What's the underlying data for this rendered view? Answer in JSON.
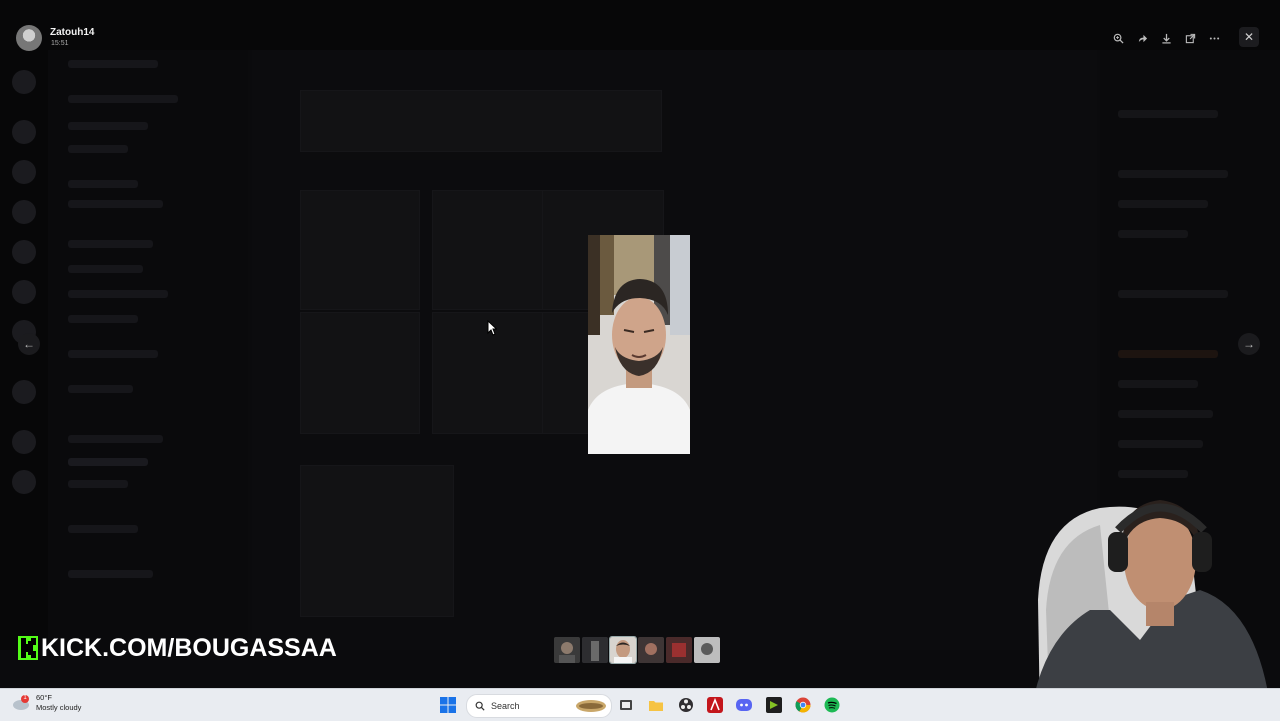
{
  "viewer": {
    "username": "Zatouh14",
    "time": "15:51",
    "toolbar_icons": [
      "zoom-in-icon",
      "forward-icon",
      "download-icon",
      "open-external-icon",
      "more-icon"
    ],
    "close_glyph": "✕",
    "prev_glyph": "←",
    "next_glyph": "→"
  },
  "overlay": {
    "kick_text": "KICK.COM/BOUGASSAA"
  },
  "thumbnails": {
    "count": 6,
    "active_index": 2
  },
  "taskbar": {
    "weather_temp": "60°F",
    "weather_desc": "Mostly cloudy",
    "weather_badge": "1",
    "search_label": "Search",
    "apps": [
      "file-explorer-icon",
      "folder-icon",
      "obs-icon",
      "affinity-icon",
      "discord-icon",
      "terminal-icon",
      "chrome-icon",
      "spotify-icon"
    ]
  },
  "colors": {
    "kick_green": "#53fc18",
    "taskbar_bg": "#e9ecf1"
  }
}
